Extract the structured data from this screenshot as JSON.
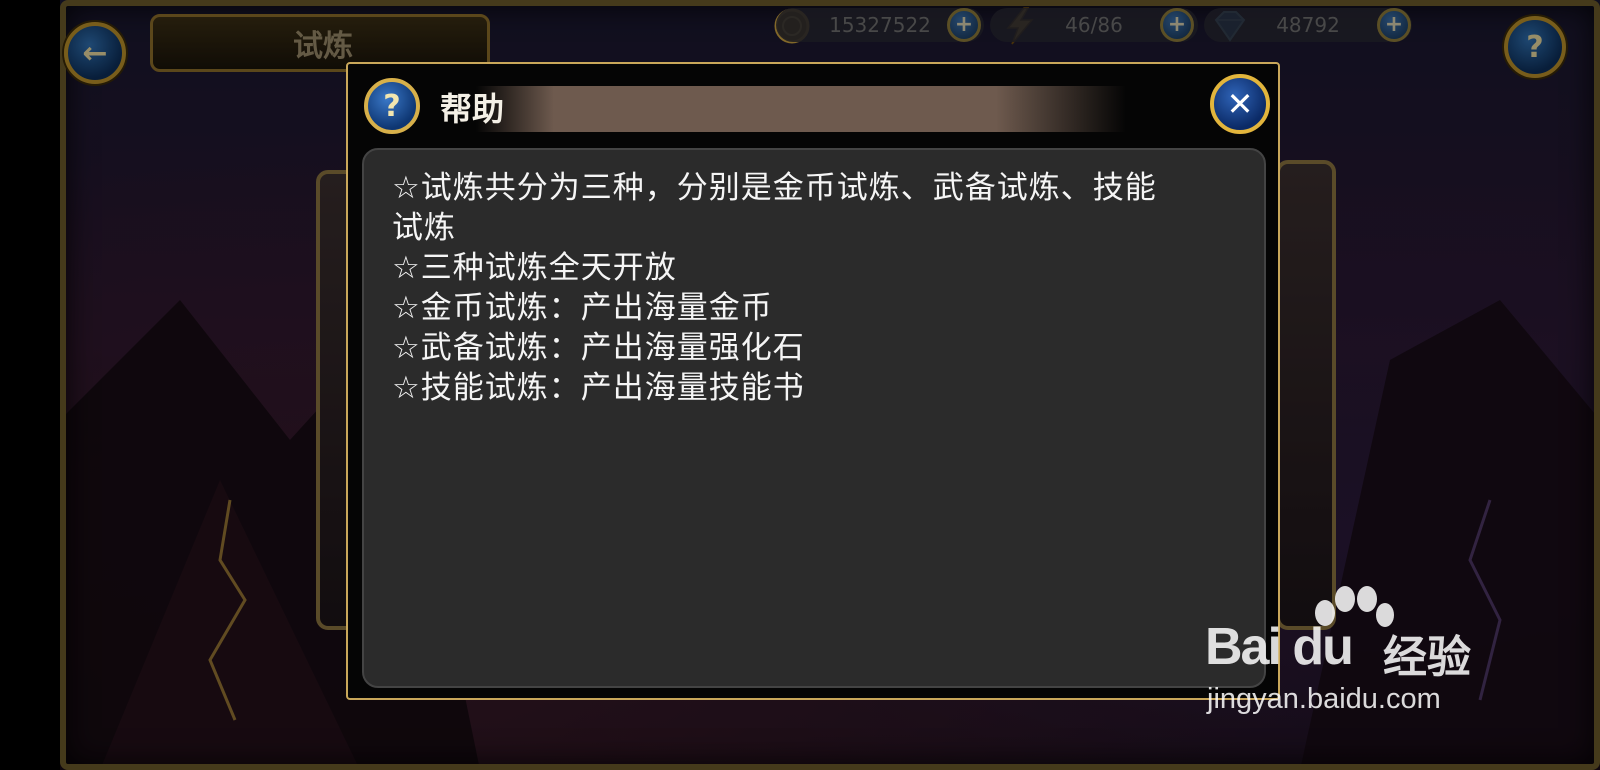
{
  "header": {
    "title": "试炼",
    "resources": {
      "gold": "15327522",
      "energy": "46/86",
      "diamond": "48792"
    },
    "help_icon": "question-icon",
    "back_icon": "back-arrow-icon"
  },
  "dialog": {
    "title": "帮助",
    "close_icon": "close-x-icon",
    "lines": [
      "☆试炼共分为三种，分别是金币试炼、武备试炼、技能",
      "试炼",
      "☆三种试炼全天开放",
      "☆金币试炼：产出海量金币",
      "☆武备试炼：产出海量强化石",
      "☆技能试炼：产出海量技能书"
    ]
  },
  "watermark": {
    "logo": "Bai du",
    "name": "经验",
    "url": "jingyan.baidu.com"
  },
  "colors": {
    "gold_border": "#c9a75a",
    "content_bg": "#2b2b2b",
    "text": "#f5f5f5"
  }
}
